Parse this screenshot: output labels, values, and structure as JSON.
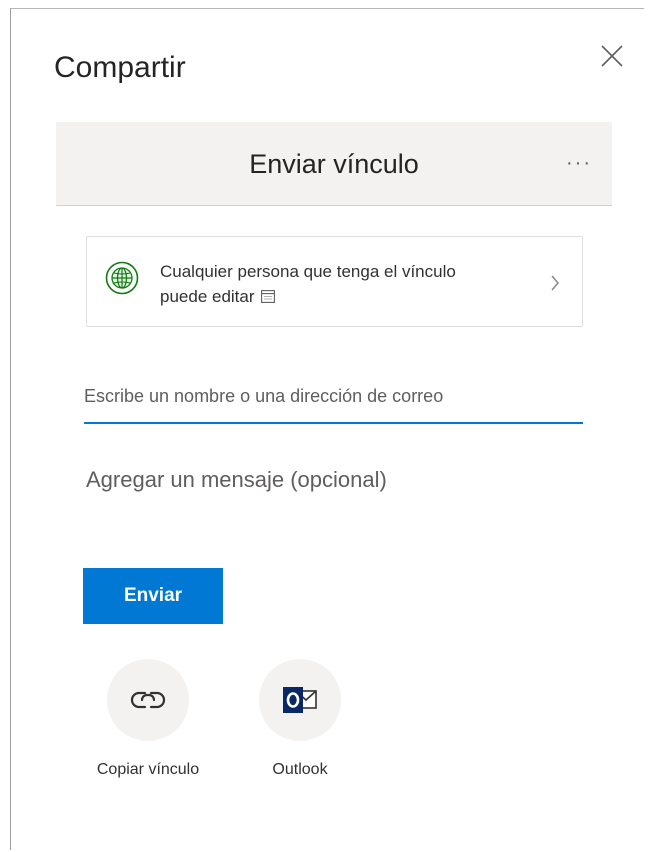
{
  "dialog": {
    "title": "Compartir",
    "close_icon": "close-icon"
  },
  "header": {
    "title": "Enviar vínculo",
    "more_label": "···"
  },
  "link_settings": {
    "icon": "globe-icon",
    "line1": "Cualquier persona que tenga el vínculo",
    "line2": "puede editar",
    "trailing_icon": "calendar-icon",
    "chevron_icon": "chevron-right-icon"
  },
  "recipients": {
    "placeholder": "Escribe un nombre o una dirección de correo"
  },
  "message": {
    "placeholder": "Agregar un mensaje (opcional)"
  },
  "send_button": {
    "label": "Enviar"
  },
  "share_options": [
    {
      "label": "Copiar vínculo",
      "icon": "link-icon"
    },
    {
      "label": "Outlook",
      "icon": "outlook-icon"
    }
  ],
  "colors": {
    "accent": "#0078d4",
    "header_bg": "#f3f2f1",
    "globe_green": "#107c10",
    "outlook_blue": "#0a2767"
  }
}
